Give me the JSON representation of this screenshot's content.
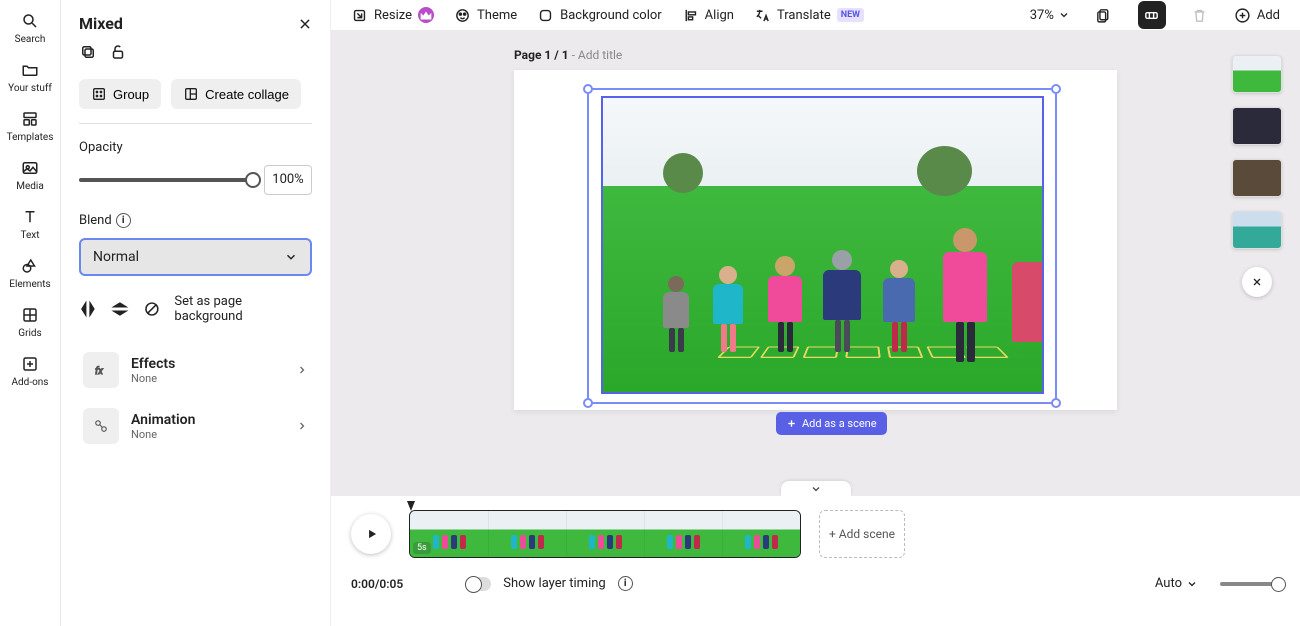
{
  "leftRail": {
    "search": "Search",
    "yourStuff": "Your stuff",
    "templates": "Templates",
    "media": "Media",
    "text": "Text",
    "elements": "Elements",
    "grids": "Grids",
    "addons": "Add-ons"
  },
  "props": {
    "title": "Mixed",
    "groupBtn": "Group",
    "collageBtn": "Create collage",
    "opacityLabel": "Opacity",
    "opacityValue": "100%",
    "blendLabel": "Blend",
    "blendValue": "Normal",
    "setBg": "Set as page background",
    "effects": {
      "title": "Effects",
      "sub": "None"
    },
    "animation": {
      "title": "Animation",
      "sub": "None"
    }
  },
  "topbar": {
    "resize": "Resize",
    "theme": "Theme",
    "bg": "Background color",
    "align": "Align",
    "translate": "Translate",
    "newBadge": "NEW",
    "zoom": "37%",
    "add": "Add"
  },
  "canvas": {
    "pagePrefix": "Page 1 / 1",
    "addTitle": " - Add title",
    "addAsScene": "Add as a scene"
  },
  "timeline": {
    "duration": "5s",
    "time": "0:00/0:05",
    "showLayer": "Show layer timing",
    "addScene": "+ Add scene",
    "speed": "Auto"
  }
}
